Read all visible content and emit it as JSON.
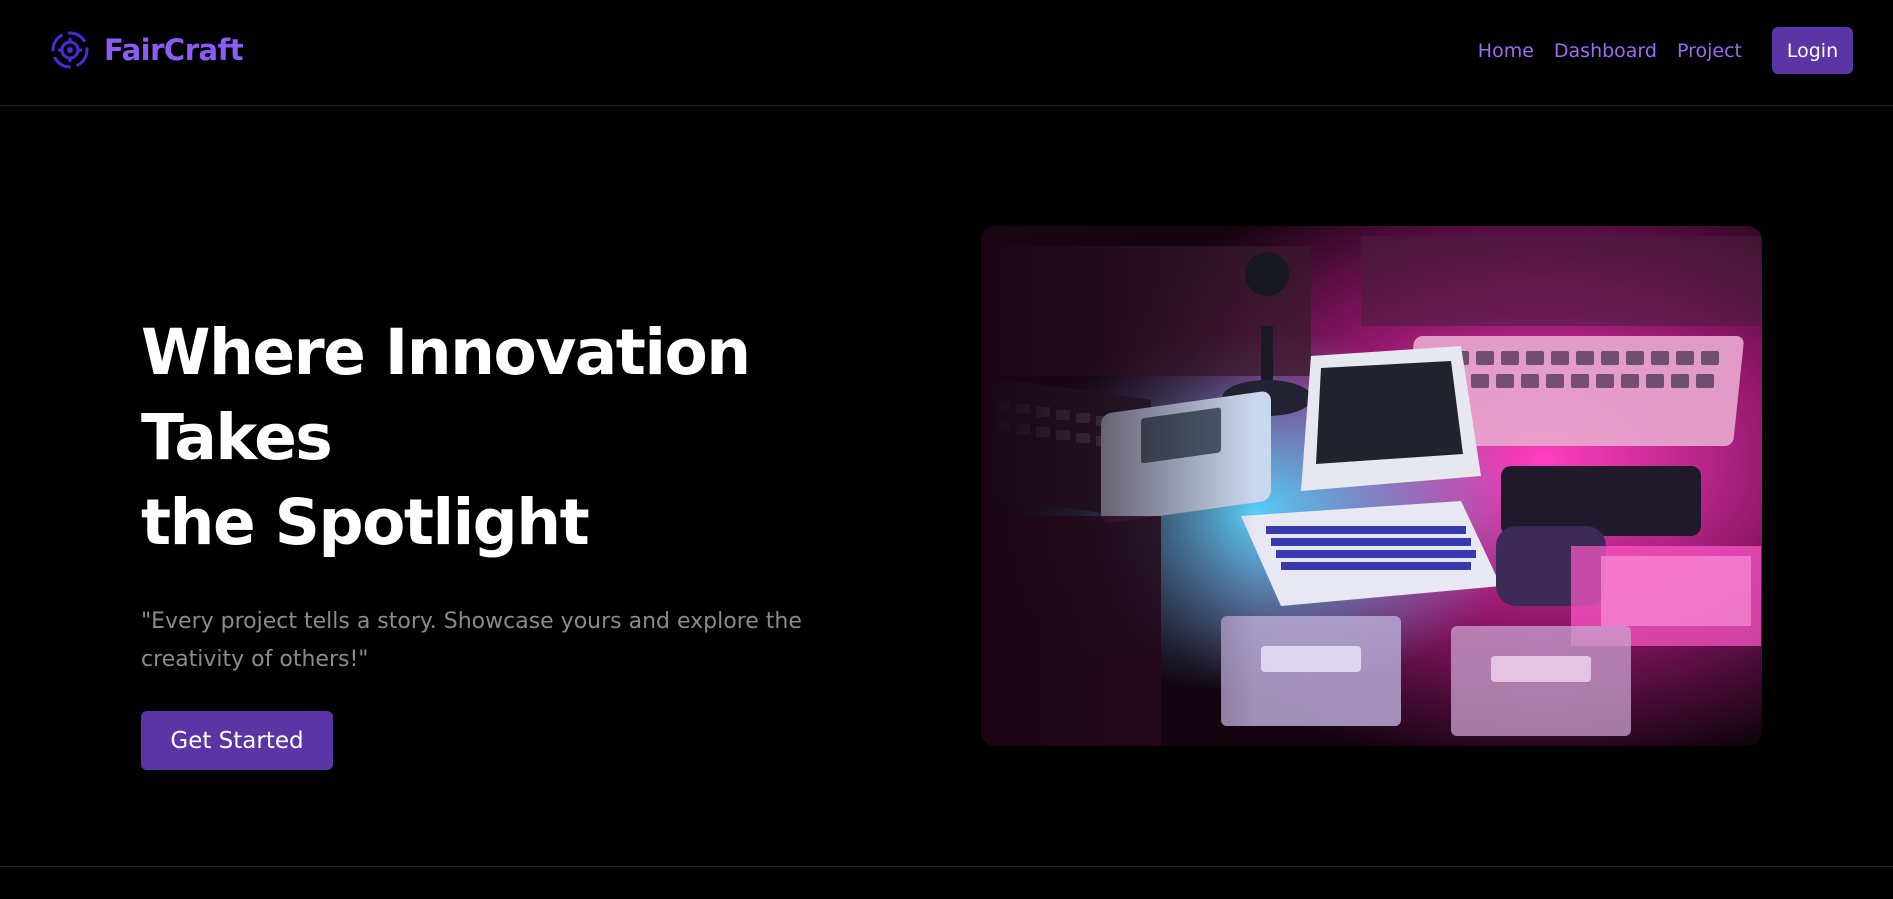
{
  "brand": {
    "name": "FairCraft",
    "logo_icon": "gear-in-ring-icon",
    "accent_color": "#8b5cf6"
  },
  "nav": {
    "links": [
      "Home",
      "Dashboard",
      "Project"
    ],
    "login_label": "Login",
    "link_color": "#9b6cf2",
    "button_color": "#5b34a6"
  },
  "hero": {
    "title_line1": "Where Innovation Takes",
    "title_line2": "the Spotlight",
    "quote": "\"Every project tells a story. Showcase yours and explore the creativity of others!\"",
    "cta_label": "Get Started",
    "image": {
      "description_icon": "retro-computers-photo",
      "palette": [
        "#ff2fb3",
        "#2ec8ff",
        "#000000"
      ]
    }
  }
}
